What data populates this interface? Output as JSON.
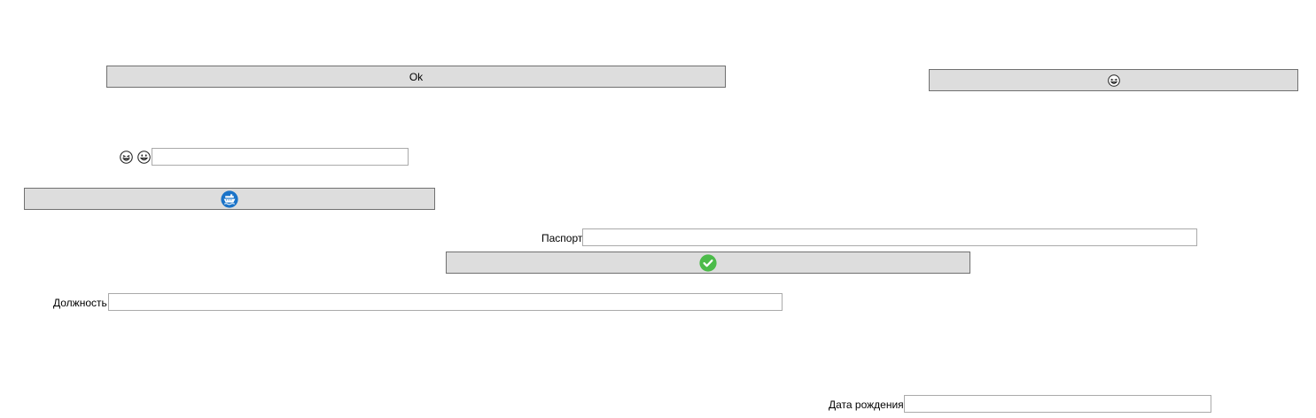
{
  "ok_button": {
    "label": "Ok",
    "icon": "ok-label"
  },
  "emoji_button": {
    "icon": "grinning-squint-face-icon"
  },
  "smiley_row": {
    "icons": [
      "grinning-squint-face-icon",
      "grinning-face-icon"
    ],
    "input_value": ""
  },
  "ship_button": {
    "icon": "ship-icon",
    "icon_color": "#1a73c8"
  },
  "passport": {
    "label": "Паспорт",
    "value": ""
  },
  "confirm_button": {
    "icon": "check-circle-icon",
    "icon_color": "#4cbb4a"
  },
  "position": {
    "label": "Должность",
    "value": ""
  },
  "birth_date": {
    "label": "Дата рождения",
    "value": ""
  }
}
